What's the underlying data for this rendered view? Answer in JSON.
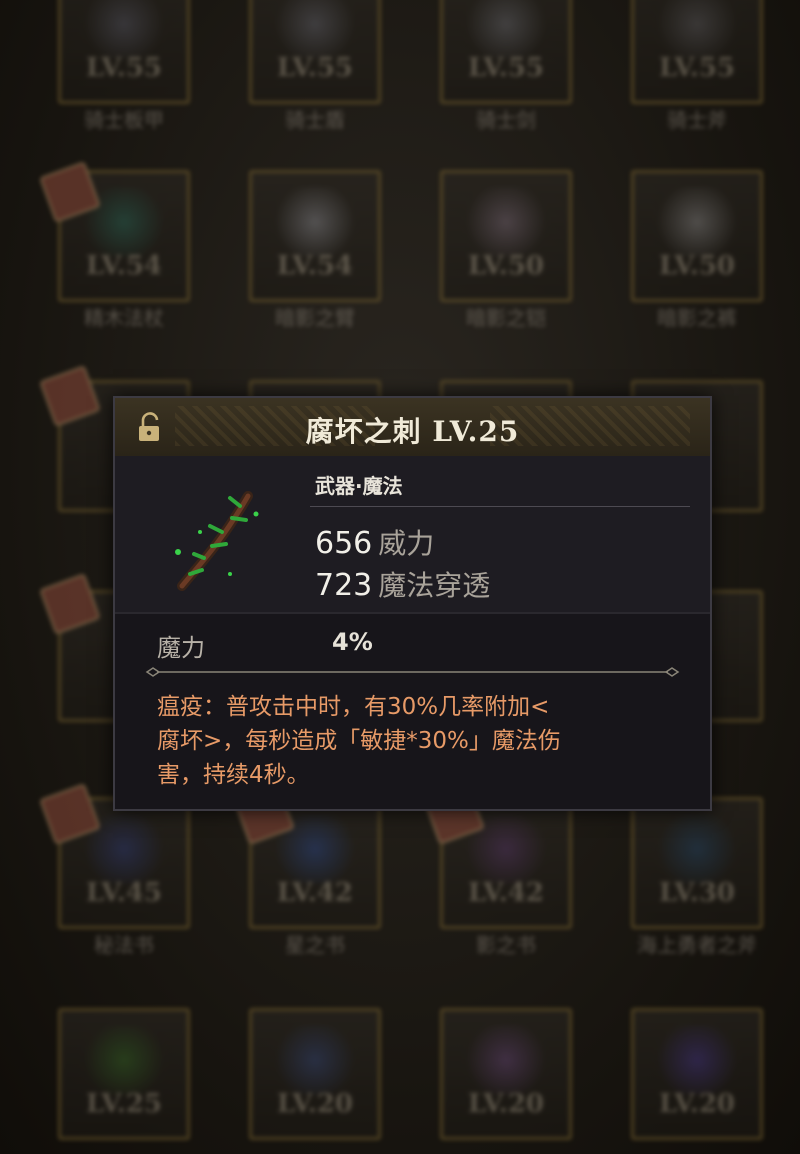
{
  "inventory": {
    "rows": [
      {
        "items": [
          {
            "level": "LV.55",
            "name": "骑士板甲",
            "art": "#5a5a66"
          },
          {
            "level": "LV.55",
            "name": "骑士盾",
            "art": "#65656e"
          },
          {
            "level": "LV.55",
            "name": "骑士剑",
            "art": "#6a6a70"
          },
          {
            "level": "LV.55",
            "name": "骑士斧",
            "art": "#5f5d60"
          }
        ]
      },
      {
        "items": [
          {
            "level": "LV.54",
            "name": "精木法杖",
            "art": "#2e6a5a"
          },
          {
            "level": "LV.54",
            "name": "暗影之臂",
            "art": "#8a8a90"
          },
          {
            "level": "LV.50",
            "name": "暗影之铠",
            "art": "#7a6a78"
          },
          {
            "level": "LV.50",
            "name": "暗影之裤",
            "art": "#8a8888"
          }
        ]
      },
      {
        "items": [
          {
            "level": "LV.45",
            "name": "秘法书",
            "art": "#34407a"
          },
          {
            "level": "LV.42",
            "name": "星之书",
            "art": "#2e4a8a"
          },
          {
            "level": "LV.42",
            "name": "影之书",
            "art": "#5a3a6a"
          },
          {
            "level": "LV.30",
            "name": "海上勇者之斧",
            "art": "#2a4a6a"
          }
        ]
      },
      {
        "items": [
          {
            "level": "LV.25",
            "name": "",
            "art": "#3a6a2a"
          },
          {
            "level": "LV.20",
            "name": "",
            "art": "#3a4a7a"
          },
          {
            "level": "LV.20",
            "name": "",
            "art": "#6a4a7a"
          },
          {
            "level": "LV.20",
            "name": "",
            "art": "#4a3a8a"
          }
        ]
      }
    ]
  },
  "tooltip": {
    "title": "腐坏之刺 LV.25",
    "category": "武器·魔法",
    "stats": [
      {
        "value": "656",
        "label": "威力"
      },
      {
        "value": "723",
        "label": "魔法穿透"
      }
    ],
    "attribute": {
      "name": "魔力",
      "value": "4%"
    },
    "description": "瘟疫：普攻击中时，有30%几率附加<\n腐坏>，每秒造成「敏捷*30%」魔法伤\n害，持续4秒。",
    "colors": {
      "description": "#e79a67",
      "frame_gold": "#7a6430",
      "header": "#3b3322"
    }
  }
}
